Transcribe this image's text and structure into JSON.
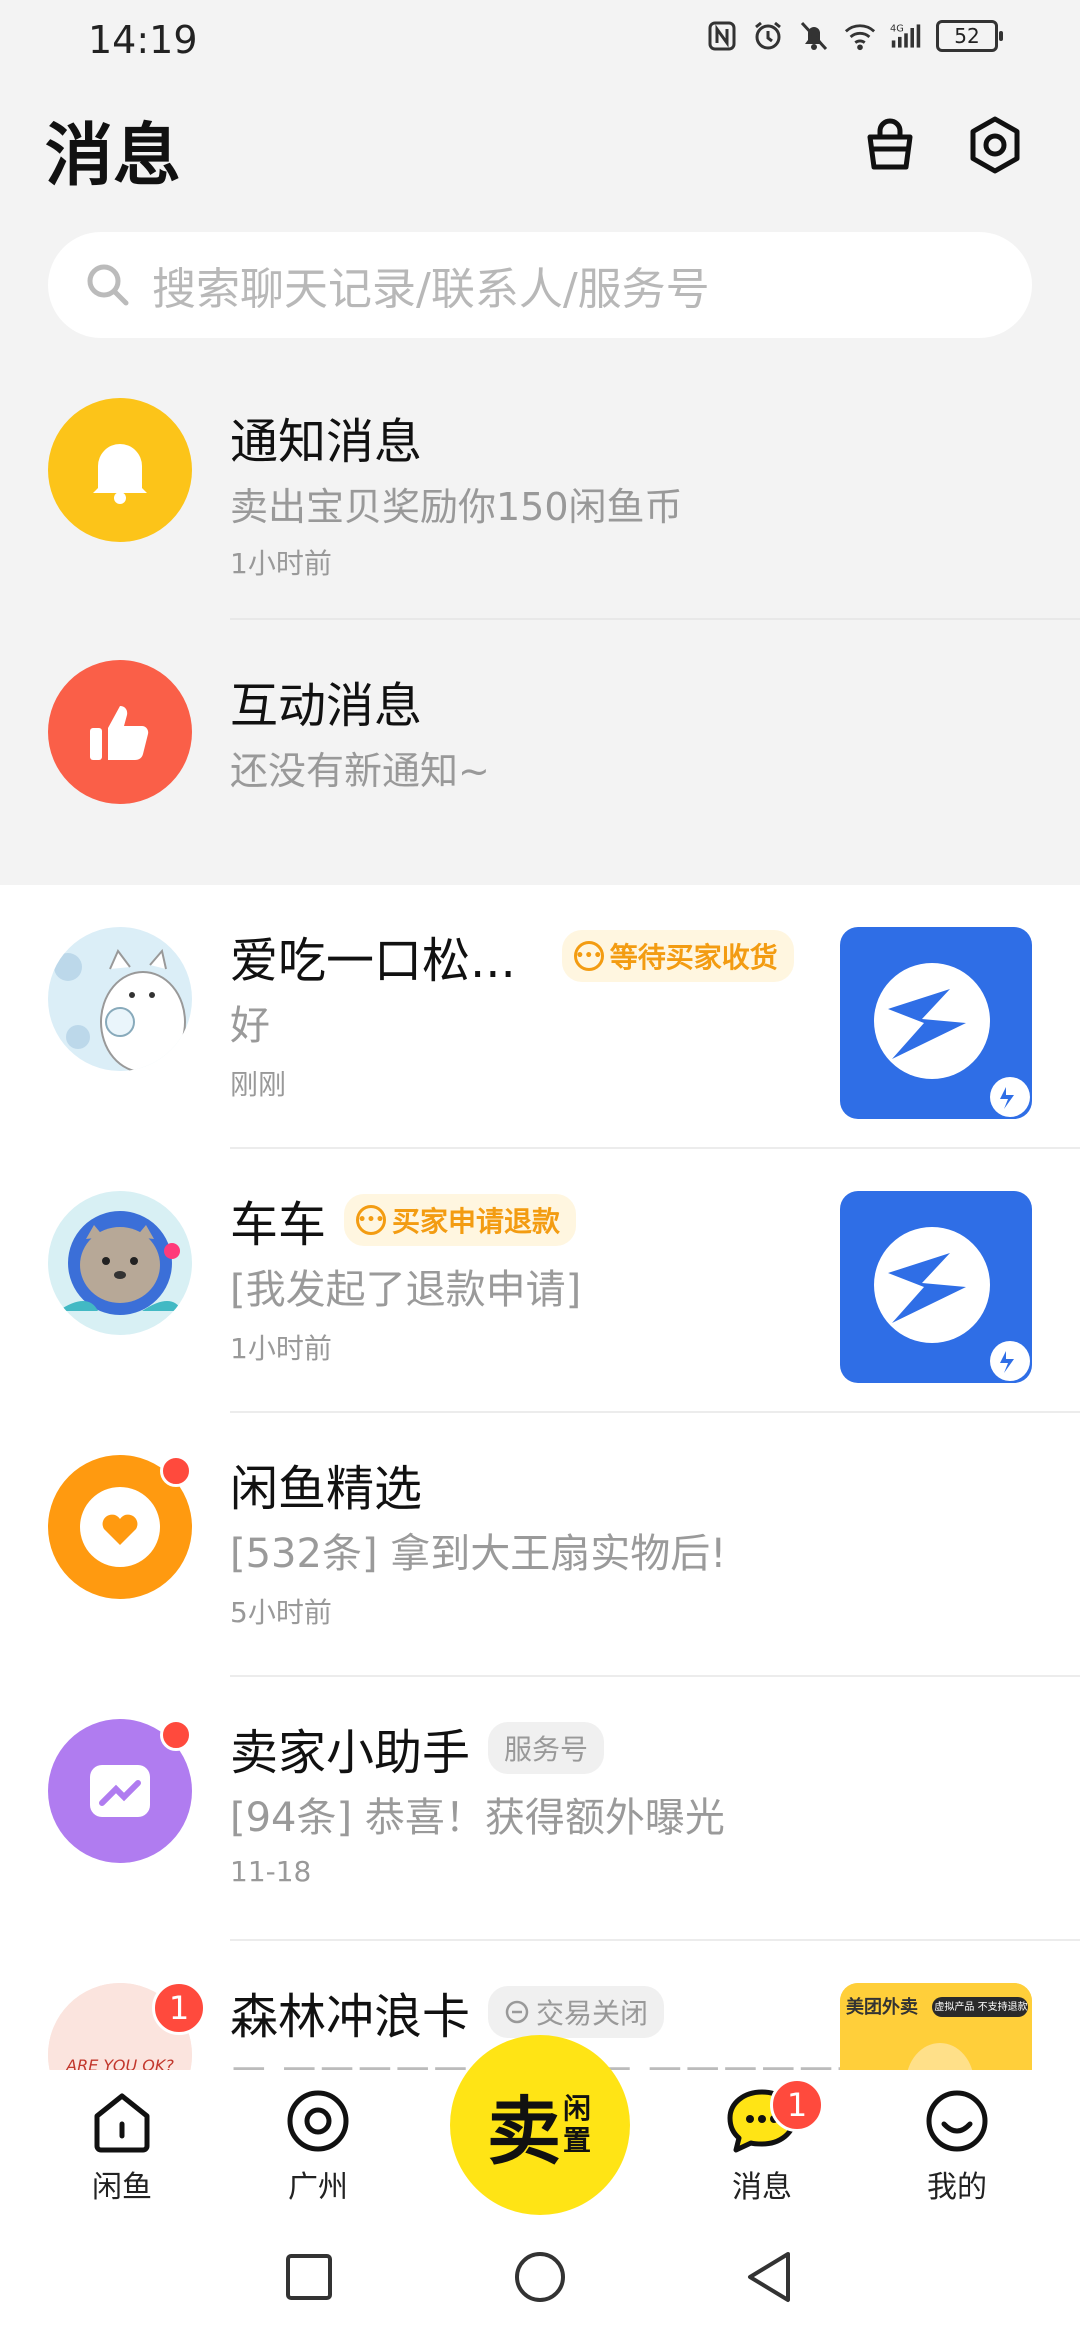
{
  "status": {
    "time": "14:19",
    "battery": "52"
  },
  "header": {
    "title": "消息"
  },
  "search": {
    "placeholder": "搜索聊天记录/联系人/服务号"
  },
  "system_items": [
    {
      "title": "通知消息",
      "subtitle": "卖出宝贝奖励你150闲鱼币",
      "time": "1小时前"
    },
    {
      "title": "互动消息",
      "subtitle": "还没有新通知~"
    }
  ],
  "chats": [
    {
      "name": "爱吃一口松...",
      "tag": "等待买家收货",
      "message": "好",
      "time": "刚刚"
    },
    {
      "name": "车车",
      "tag": "买家申请退款",
      "message": "[我发起了退款申请]",
      "time": "1小时前"
    },
    {
      "name": "闲鱼精选",
      "message": "[532条] 拿到大王扇实物后!",
      "time": "5小时前"
    },
    {
      "name": "卖家小助手",
      "tag": "服务号",
      "message": "[94条] 恭喜！获得额外曝光",
      "time": "11-18"
    },
    {
      "name": "森林冲浪卡",
      "tag": "交易关闭",
      "badge": "1",
      "avatar_text": "ARE YOU OK?",
      "thumb_top": "美团外卖",
      "thumb_tag": "虚拟产品 不支持退款"
    }
  ],
  "bottom_nav": {
    "items": [
      {
        "label": "闲鱼"
      },
      {
        "label": "广州"
      },
      {
        "label": "消息",
        "badge": "1"
      },
      {
        "label": "我的"
      }
    ],
    "sell": {
      "main": "卖",
      "sub": "闲置"
    }
  },
  "colors": {
    "accent": "#ffe415",
    "notify": "#fcc419",
    "interact": "#fa5f48",
    "badge": "#ff4a3d",
    "tag_orange": "#f39c12"
  }
}
